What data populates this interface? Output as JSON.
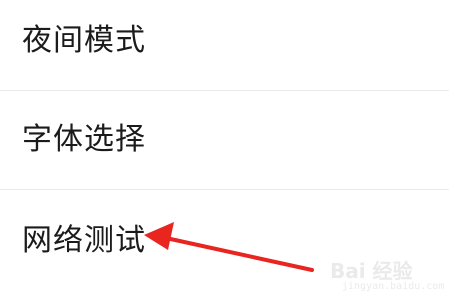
{
  "settings": {
    "items": [
      {
        "label": "夜间模式"
      },
      {
        "label": "字体选择"
      },
      {
        "label": "网络测试"
      }
    ]
  },
  "annotation": {
    "arrow_color": "#e8251f",
    "icon": "red-arrow-icon"
  },
  "watermark": {
    "brand": "Bai 经验",
    "sub": "jingyan.baidu.com"
  }
}
